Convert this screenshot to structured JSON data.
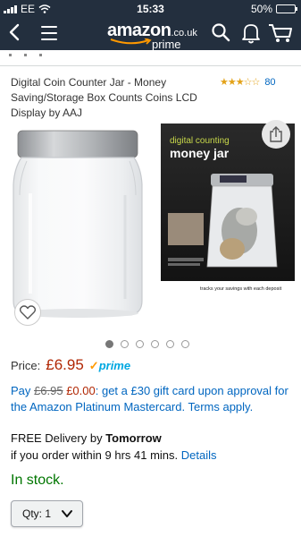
{
  "status_bar": {
    "carrier": "EE",
    "time": "15:33",
    "battery": "50%",
    "battery_level": 0.5
  },
  "header": {
    "logo_text": "amazon",
    "logo_tld": ".co.uk",
    "logo_prime": "prime",
    "back_icon": "chevron-left-icon",
    "menu_icon": "hamburger-icon",
    "search_icon": "search-icon",
    "bell_icon": "bell-icon",
    "cart_icon": "cart-icon"
  },
  "product": {
    "title": "Digital Coin Counter Jar - Money Saving/Storage Box Counts Coins LCD Display by AAJ",
    "rating_stars": "★★★☆☆",
    "rating_value": 3,
    "rating_count": "80"
  },
  "gallery": {
    "image_count": 6,
    "active_index": 0,
    "box_heading_1": "digital counting",
    "box_heading_2": "money jar",
    "box_tagline": "tracks your savings with each deposit"
  },
  "price": {
    "label": "Price:",
    "value": "£6.95",
    "prime_label": "prime",
    "prime_check": "✓"
  },
  "offer": {
    "pay": "Pay",
    "old_price": "£6.95",
    "new_price": "£0.00",
    "text": ": get a £30 gift card upon approval for the Amazon Platinum Mastercard. Terms apply."
  },
  "delivery": {
    "line1_prefix": "FREE Delivery by",
    "line1_day": "Tomorrow",
    "line2": "if you order within 9 hrs 41 mins.",
    "details_link": "Details"
  },
  "stock": "In stock.",
  "quantity": {
    "label": "Qty:",
    "value": "1"
  },
  "colors": {
    "header_bg": "#232f3e",
    "price_red": "#b12704",
    "link_blue": "#0066c0",
    "stock_green": "#007600",
    "prime_blue": "#00a8e1",
    "star_orange": "#e3a218"
  }
}
